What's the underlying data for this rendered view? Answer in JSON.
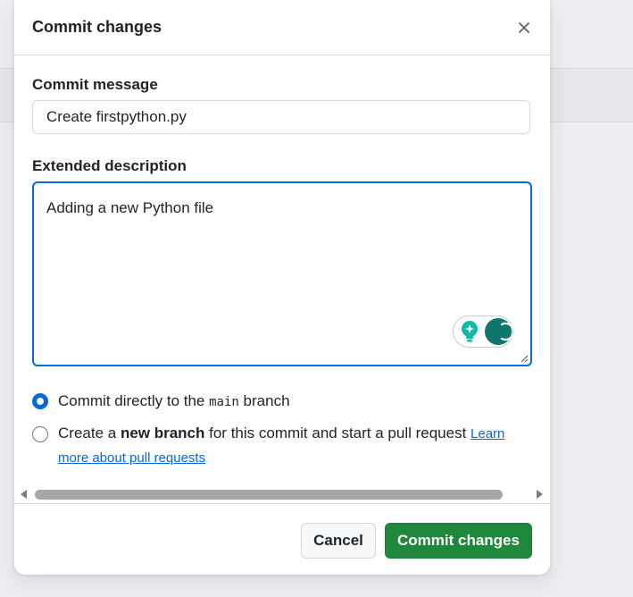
{
  "dialog": {
    "title": "Commit changes",
    "close_icon": "close-icon"
  },
  "commit_message": {
    "label": "Commit message",
    "value": "Create firstpython.py"
  },
  "extended_description": {
    "label": "Extended description",
    "value": "Adding a new Python file"
  },
  "options": {
    "direct": {
      "prefix": "Commit directly to the ",
      "branch": "main",
      "suffix": " branch",
      "selected": true
    },
    "new_branch": {
      "prefix": "Create a ",
      "bold": "new branch",
      "suffix": " for this commit and start a pull request ",
      "link_line1": "Learn",
      "link_line2": "more about pull requests",
      "selected": false
    }
  },
  "footer": {
    "cancel_label": "Cancel",
    "commit_label": "Commit changes"
  },
  "colors": {
    "primary_button": "#1f883d",
    "focus_border": "#0969da",
    "link": "#0969da"
  }
}
